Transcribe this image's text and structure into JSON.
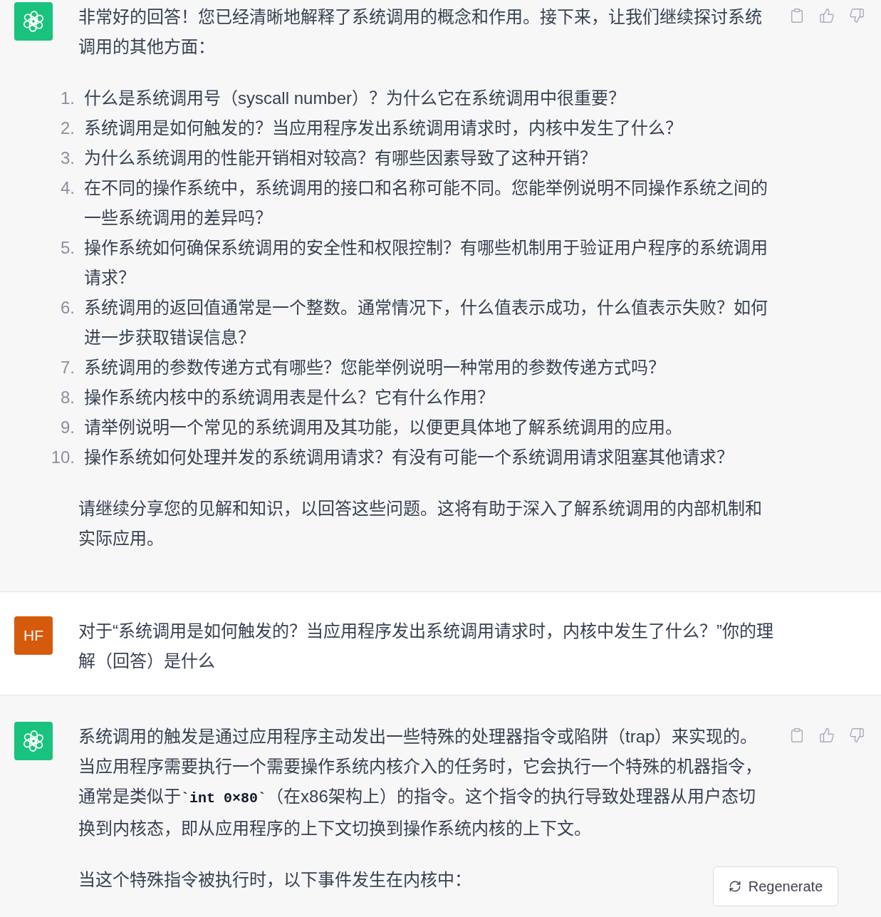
{
  "messages": [
    {
      "kind": "assistant",
      "blocks": [
        {
          "kind": "paragraph",
          "parts": [
            {
              "kind": "text",
              "text": "非常好的回答！您已经清晰地解释了系统调用的概念和作用。接下来，让我们继续探讨系统调用的其他方面："
            }
          ]
        },
        {
          "kind": "list",
          "items": [
            {
              "number": "1.",
              "text": "什么是系统调用号（syscall number）？为什么它在系统调用中很重要？"
            },
            {
              "number": "2.",
              "text": "系统调用是如何触发的？当应用程序发出系统调用请求时，内核中发生了什么？"
            },
            {
              "number": "3.",
              "text": "为什么系统调用的性能开销相对较高？有哪些因素导致了这种开销？"
            },
            {
              "number": "4.",
              "text": "在不同的操作系统中，系统调用的接口和名称可能不同。您能举例说明不同操作系统之间的一些系统调用的差异吗？"
            },
            {
              "number": "5.",
              "text": "操作系统如何确保系统调用的安全性和权限控制？有哪些机制用于验证用户程序的系统调用请求？"
            },
            {
              "number": "6.",
              "text": "系统调用的返回值通常是一个整数。通常情况下，什么值表示成功，什么值表示失败？如何进一步获取错误信息？"
            },
            {
              "number": "7.",
              "text": "系统调用的参数传递方式有哪些？您能举例说明一种常用的参数传递方式吗？"
            },
            {
              "number": "8.",
              "text": "操作系统内核中的系统调用表是什么？它有什么作用？"
            },
            {
              "number": "9.",
              "text": "请举例说明一个常见的系统调用及其功能，以便更具体地了解系统调用的应用。"
            },
            {
              "number": "10.",
              "text": "操作系统如何处理并发的系统调用请求？有没有可能一个系统调用请求阻塞其他请求？"
            }
          ]
        },
        {
          "kind": "paragraph",
          "parts": [
            {
              "kind": "text",
              "text": "请继续分享您的见解和知识，以回答这些问题。这将有助于深入了解系统调用的内部机制和实际应用。"
            }
          ]
        }
      ]
    },
    {
      "kind": "user",
      "initials": "HF",
      "blocks": [
        {
          "kind": "paragraph",
          "parts": [
            {
              "kind": "text",
              "text": "对于“系统调用是如何触发的？当应用程序发出系统调用请求时，内核中发生了什么？”你的理解（回答）是什么"
            }
          ]
        }
      ]
    },
    {
      "kind": "assistant",
      "blocks": [
        {
          "kind": "paragraph",
          "parts": [
            {
              "kind": "text",
              "text": "系统调用的触发是通过应用程序主动发出一些特殊的处理器指令或陷阱（trap）来实现的。当应用程序需要执行一个需要操作系统内核介入的任务时，它会执行一个特殊的机器指令，通常是类似于"
            },
            {
              "kind": "code",
              "text": "`int 0×80`"
            },
            {
              "kind": "text",
              "text": "（在x86架构上）的指令。这个指令的执行导致处理器从用户态切换到内核态，即从应用程序的上下文切换到操作系统内核的上下文。"
            }
          ]
        },
        {
          "kind": "paragraph",
          "parts": [
            {
              "kind": "text",
              "text": "当这个特殊指令被执行时，以下事件发生在内核中："
            }
          ]
        }
      ]
    }
  ],
  "regenerate_button": {
    "label": "Regenerate"
  }
}
